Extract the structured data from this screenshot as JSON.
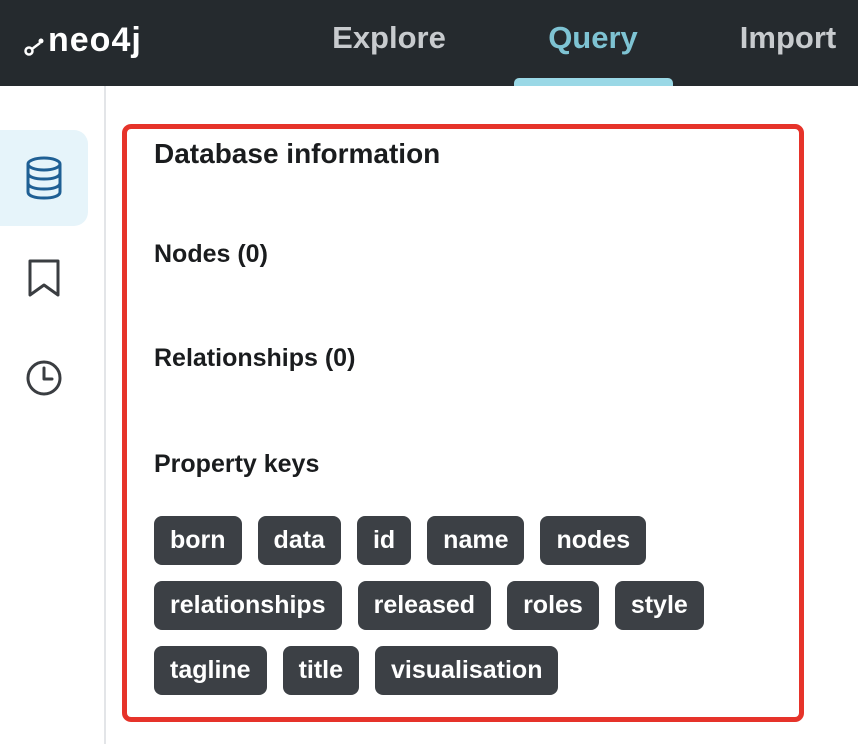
{
  "header": {
    "logo_text": "neo4j",
    "nav": [
      {
        "label": "Explore",
        "active": false
      },
      {
        "label": "Query",
        "active": true
      },
      {
        "label": "Import",
        "active": false
      }
    ],
    "active_color": "#7ec3d3",
    "background": "#252a2e"
  },
  "sidebar": {
    "items": [
      {
        "icon": "database-icon",
        "active": true
      },
      {
        "icon": "bookmark-icon",
        "active": false
      },
      {
        "icon": "history-clock-icon",
        "active": false
      }
    ]
  },
  "panel": {
    "title": "Database information",
    "nodes_label": "Nodes (0)",
    "relationships_label": "Relationships (0)",
    "property_keys_label": "Property keys",
    "property_keys": [
      "born",
      "data",
      "id",
      "name",
      "nodes",
      "relationships",
      "released",
      "roles",
      "style",
      "tagline",
      "title",
      "visualisation"
    ],
    "highlight_color": "#e6332a"
  }
}
